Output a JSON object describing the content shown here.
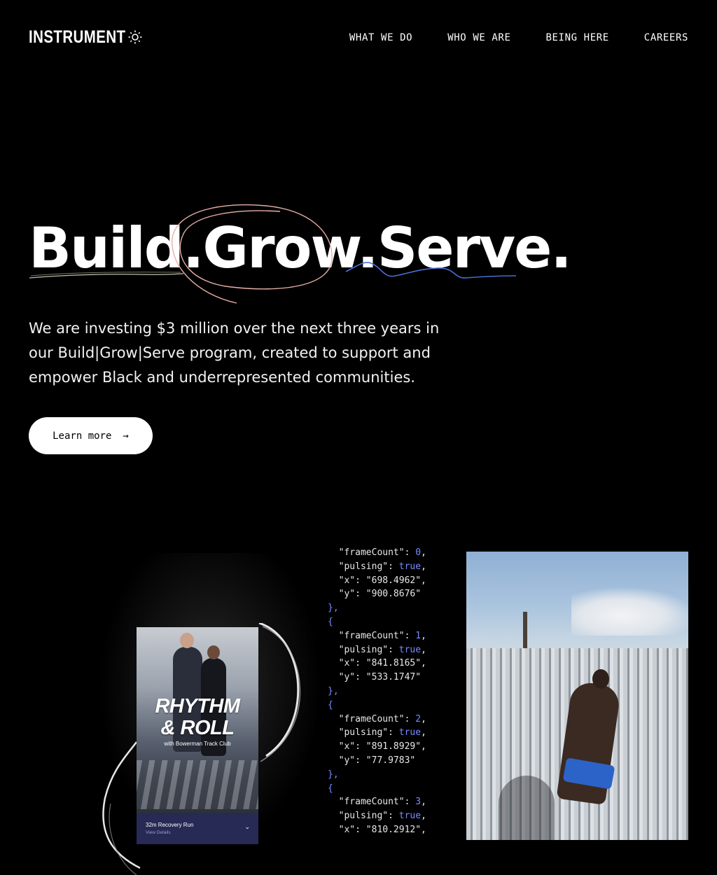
{
  "header": {
    "logo": "INSTRUMENT",
    "theme_toggle_icon": "sun-icon",
    "nav": [
      {
        "label": "WHAT WE DO"
      },
      {
        "label": "WHO WE ARE"
      },
      {
        "label": "BEING HERE"
      },
      {
        "label": "CAREERS"
      }
    ]
  },
  "hero": {
    "title": "Build.Grow.Serve.",
    "description": "We are investing $3 million over the next three years in our Build|Grow|Serve program, created to support and empower Black and underrepresented communities.",
    "cta_label": "Learn more",
    "cta_icon": "arrow-right-icon",
    "accent_colors": {
      "underline_build": "#bfc2a8",
      "circle_grow": "#e8b0a8",
      "squiggle_serve": "#4a6fd8"
    }
  },
  "showcase": {
    "phone": {
      "title_line1": "RHYTHM",
      "title_line2": "& ROLL",
      "subtitle": "with Bowerman Track Club",
      "item_title": "32m Recovery Run",
      "item_link": "View Details",
      "chevron_icon": "chevron-down-icon"
    },
    "code_lines": [
      "  \"frameCount\": 0,",
      "  \"pulsing\": true,",
      "  \"x\": \"698.4962\",",
      "  \"y\": \"900.8676\"",
      "},",
      "{",
      "  \"frameCount\": 1,",
      "  \"pulsing\": true,",
      "  \"x\": \"841.8165\",",
      "  \"y\": \"533.1747\"",
      "},",
      "{",
      "  \"frameCount\": 2,",
      "  \"pulsing\": true,",
      "  \"x\": \"891.8929\",",
      "  \"y\": \"77.9783\"",
      "},",
      "{",
      "  \"frameCount\": 3,",
      "  \"pulsing\": true,",
      "  \"x\": \"810.2912\","
    ]
  }
}
